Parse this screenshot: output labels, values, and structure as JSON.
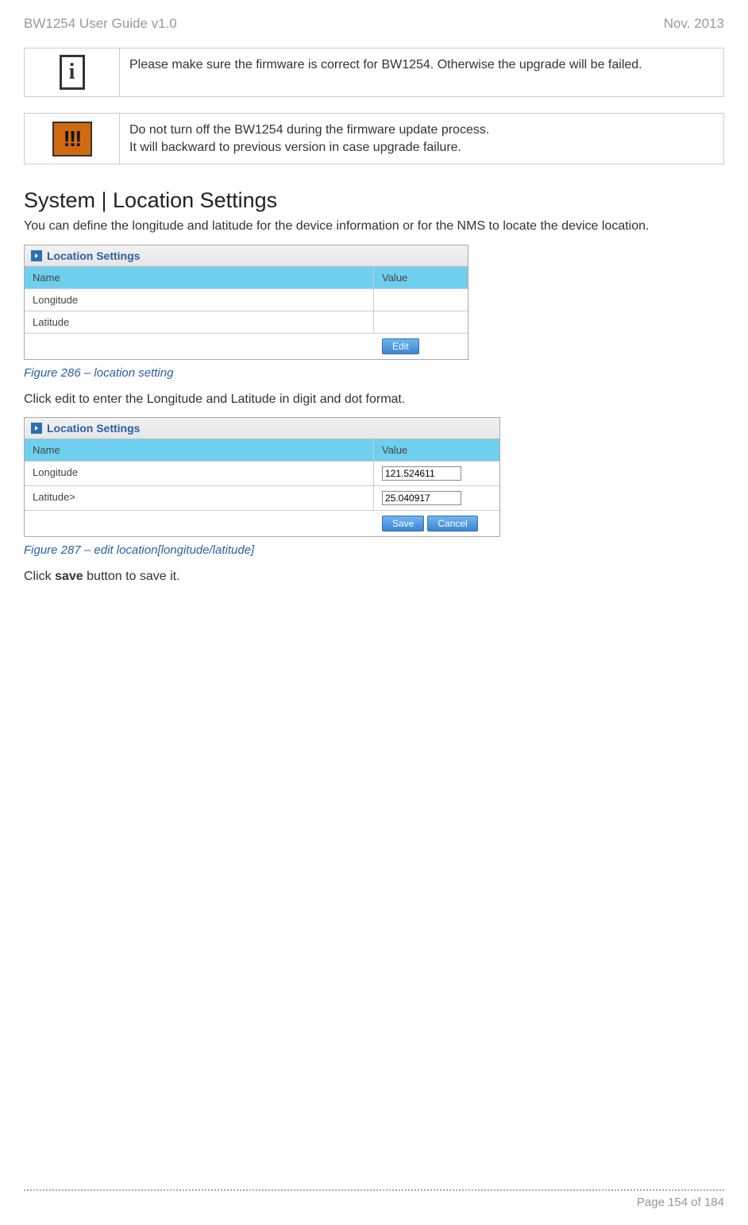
{
  "header": {
    "left": "BW1254 User Guide v1.0",
    "right": "Nov.  2013"
  },
  "info_box": {
    "text": "Please make sure the firmware is correct for BW1254. Otherwise the upgrade will be failed."
  },
  "warn_box": {
    "line1": "Do not turn off the BW1254 during the firmware update process.",
    "line2": "It will backward to previous version in case upgrade failure."
  },
  "section_title": "System | Location Settings",
  "section_intro": "You can define the longitude and latitude for the device information or for the NMS to locate the device location.",
  "figure1": {
    "panel_title": "Location Settings",
    "col_name": "Name",
    "col_value": "Value",
    "row_lon": "Longitude",
    "row_lat": "Latitude",
    "btn_edit": "Edit",
    "caption": "Figure 286 – location setting"
  },
  "after_fig1": "Click edit to enter the Longitude and Latitude in digit and dot format.",
  "figure2": {
    "panel_title": "Location Settings",
    "col_name": "Name",
    "col_value": "Value",
    "row_lon": "Longitude",
    "row_lat": "Latitude>",
    "val_lon": "121.524611",
    "val_lat": "25.040917",
    "btn_save": "Save",
    "btn_cancel": "Cancel",
    "caption": "Figure 287 – edit location[longitude/latitude]"
  },
  "after_fig2_pre": "Click ",
  "after_fig2_bold": "save",
  "after_fig2_post": " button to save it.",
  "footer": "Page 154 of 184"
}
